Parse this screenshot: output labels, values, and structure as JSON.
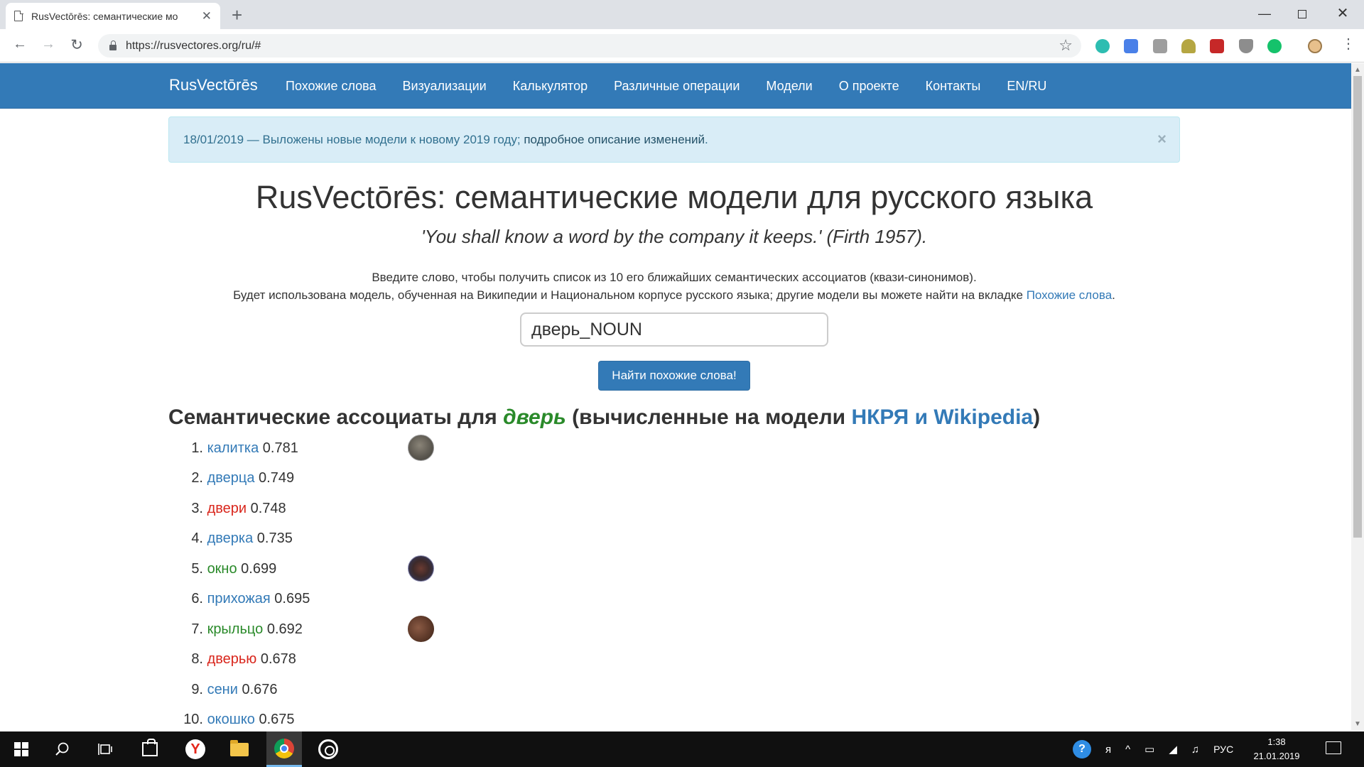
{
  "browser": {
    "tab_title": "RusVectōrēs: семантические мо",
    "new_tab_symbol": "+",
    "close_symbol": "✕",
    "url": "https://rusvectores.org/ru/#",
    "window_min": "—",
    "window_close": "✕",
    "back_symbol": "←",
    "forward_symbol": "→",
    "reload_symbol": "↻",
    "star_symbol": "☆",
    "menu_symbol": "⋮"
  },
  "navbar": {
    "brand": "RusVectōrēs",
    "links": [
      "Похожие слова",
      "Визуализации",
      "Калькулятор",
      "Различные операции",
      "Модели",
      "О проекте",
      "Контакты",
      "EN/RU"
    ],
    "accent_color": "#337ab7"
  },
  "alert": {
    "text": "18/01/2019 — Выложены новые модели к новому 2019 году; ",
    "link": "подробное описание изменений",
    "suffix": ".",
    "close_symbol": "×"
  },
  "main": {
    "title": "RusVectōrēs: семантические модели для русского языка",
    "quote": "'You shall know a word by the company it keeps.' (Firth 1957).",
    "intro_line1": "Введите слово, чтобы получить список из 10 его ближайших семантических ассоциатов (квази-синонимов).",
    "intro_line2": "Будет использована модель, обученная на Википедии и Национальном корпусе русского языка; другие модели вы можете найти на вкладке ",
    "intro_link": "Похожие слова",
    "intro_suffix": ".",
    "search_value": "дверь_NOUN",
    "search_button": "Найти похожие слова!"
  },
  "results": {
    "heading_prefix": "Семантические ассоциаты для ",
    "query_word": "дверь",
    "heading_middle": " (вычисленные на модели ",
    "model_link": "НКРЯ и Wikipedia",
    "heading_suffix": ")",
    "items": [
      {
        "num": "1.",
        "word": "калитка",
        "score": "0.781",
        "color": "#337ab7"
      },
      {
        "num": "2.",
        "word": "дверца",
        "score": "0.749",
        "color": "#337ab7"
      },
      {
        "num": "3.",
        "word": "двери",
        "score": "0.748",
        "color": "#d9261c"
      },
      {
        "num": "4.",
        "word": "дверка",
        "score": "0.735",
        "color": "#337ab7"
      },
      {
        "num": "5.",
        "word": "окно",
        "score": "0.699",
        "color": "#2a8a2a"
      },
      {
        "num": "6.",
        "word": "прихожая",
        "score": "0.695",
        "color": "#337ab7"
      },
      {
        "num": "7.",
        "word": "крыльцо",
        "score": "0.692",
        "color": "#2a8a2a"
      },
      {
        "num": "8.",
        "word": "дверью",
        "score": "0.678",
        "color": "#d9261c"
      },
      {
        "num": "9.",
        "word": "сени",
        "score": "0.676",
        "color": "#337ab7"
      },
      {
        "num": "10.",
        "word": "окошко",
        "score": "0.675",
        "color": "#337ab7"
      }
    ]
  },
  "taskbar": {
    "yandex_letter": "Y",
    "help_symbol": "?",
    "tray_glyphs": [
      "ᴙ",
      "^",
      "▭",
      "◢",
      "♫"
    ],
    "language": "РУС",
    "time": "1:38",
    "date": "21.01.2019"
  }
}
